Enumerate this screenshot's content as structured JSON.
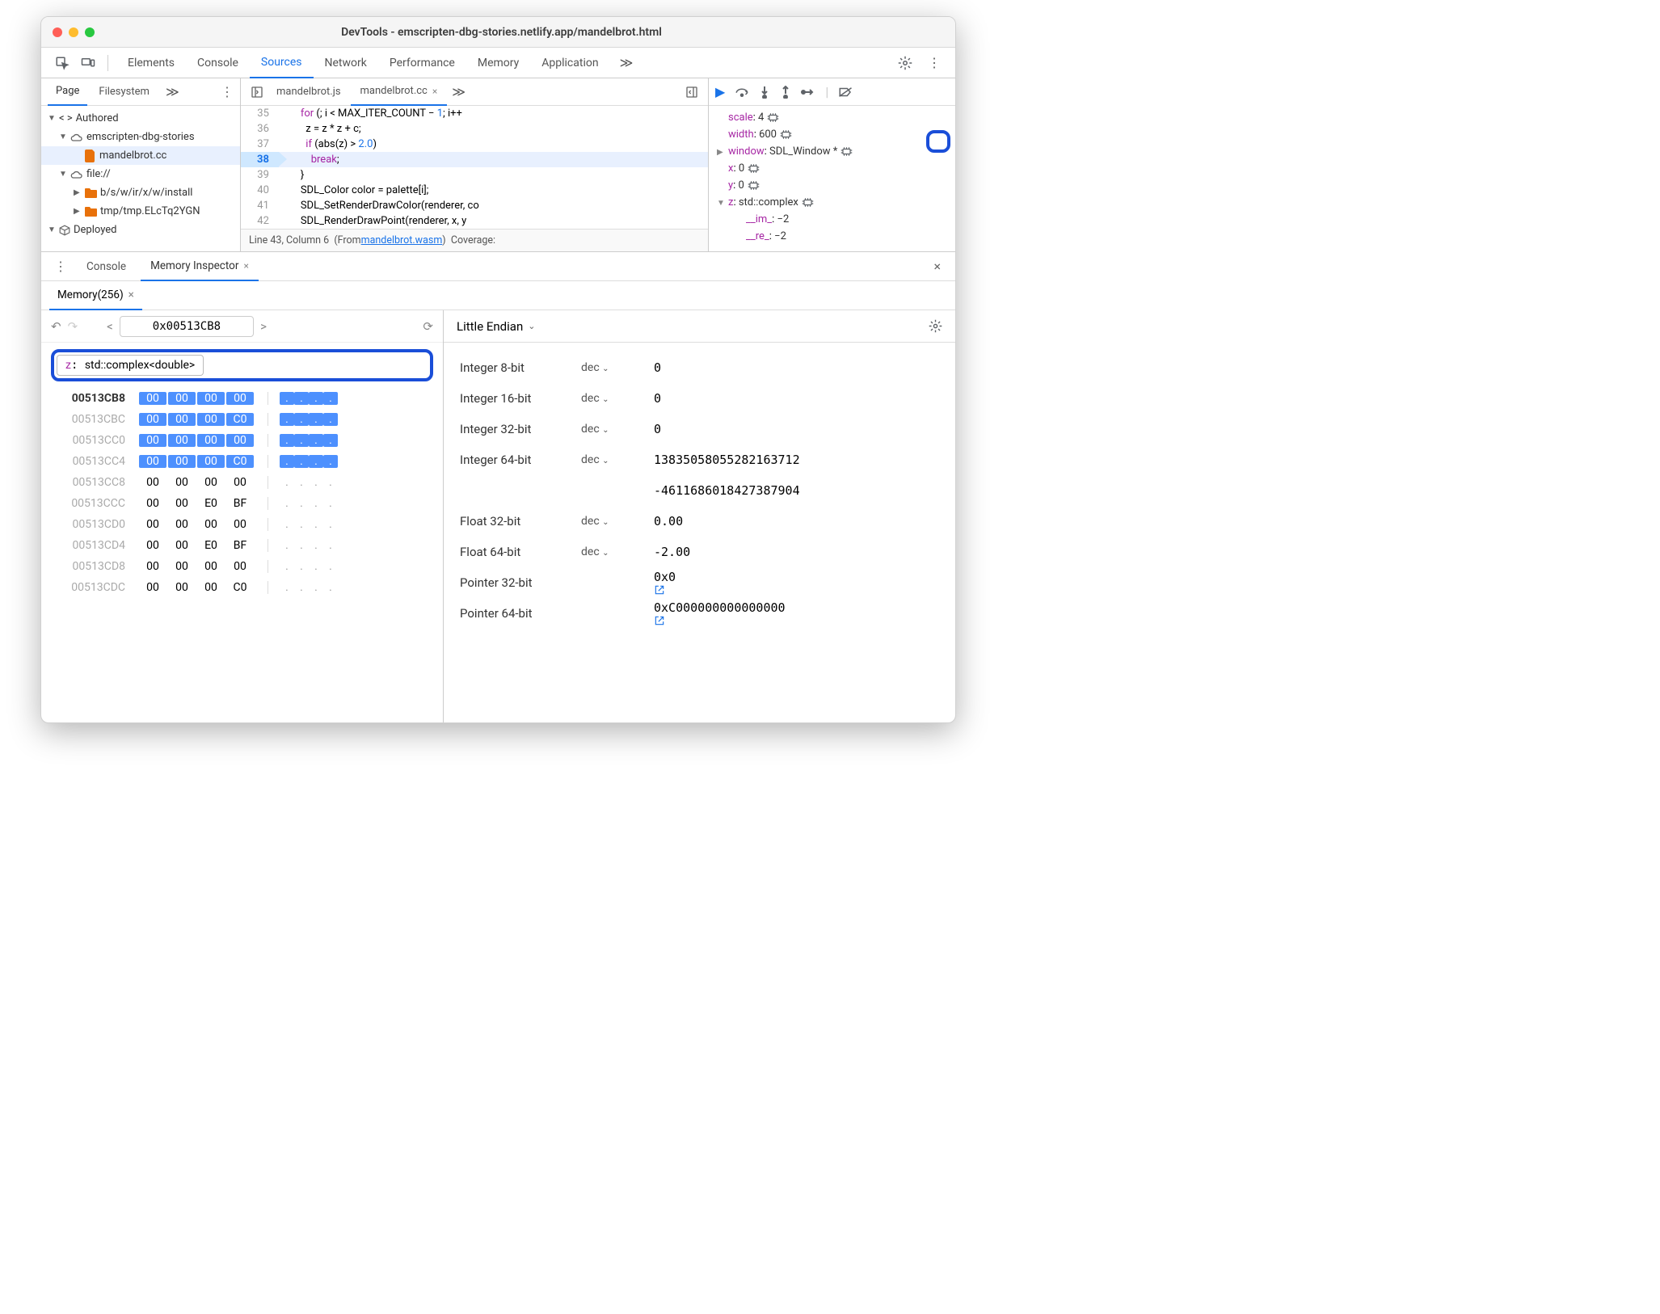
{
  "title": "DevTools - emscripten-dbg-stories.netlify.app/mandelbrot.html",
  "mainTabs": [
    "Elements",
    "Console",
    "Sources",
    "Network",
    "Performance",
    "Memory",
    "Application"
  ],
  "mainActive": "Sources",
  "leftTabs": [
    "Page",
    "Filesystem"
  ],
  "leftActive": "Page",
  "tree": {
    "authored": "Authored",
    "site": "emscripten-dbg-stories",
    "file": "mandelbrot.cc",
    "file2": "file://",
    "sub1": "b/s/w/ir/x/w/install",
    "sub2": "tmp/tmp.ELcTq2YGN",
    "deployed": "Deployed"
  },
  "codeTabs": [
    "mandelbrot.js",
    "mandelbrot.cc"
  ],
  "codeActive": "mandelbrot.cc",
  "codeLines": [
    {
      "n": 35,
      "t": "    for (; i < MAX_ITER_COUNT − 1; i++"
    },
    {
      "n": 36,
      "t": "      z = z * z + c;"
    },
    {
      "n": 37,
      "t": "      if (abs(z) > 2.0)"
    },
    {
      "n": 38,
      "t": "        break;",
      "cur": true
    },
    {
      "n": 39,
      "t": "    }"
    },
    {
      "n": 40,
      "t": "    SDL_Color color = palette[i];"
    },
    {
      "n": 41,
      "t": "    SDL_SetRenderDrawColor(renderer, co"
    },
    {
      "n": 42,
      "t": "    SDL_RenderDrawPoint(renderer, x, y"
    }
  ],
  "status": {
    "pos": "Line 43, Column 6",
    "from": "(From ",
    "wasm": "mandelbrot.wasm",
    "close": ")",
    "cov": "Coverage:"
  },
  "scope": [
    {
      "k": "scale",
      "v": "4",
      "icon": true
    },
    {
      "k": "width",
      "v": "600",
      "icon": true
    },
    {
      "k": "window",
      "v": "SDL_Window *",
      "icon": true,
      "exp": "▶"
    },
    {
      "k": "x",
      "v": "0",
      "icon": true
    },
    {
      "k": "y",
      "v": "0",
      "icon": true
    },
    {
      "k": "z",
      "v": "std::complex<double>",
      "icon": true,
      "exp": "▼",
      "hl": true
    },
    {
      "k": "__im_",
      "v": "−2",
      "indent": true
    },
    {
      "k": "__re_",
      "v": "−2",
      "indent": true
    }
  ],
  "drawer": {
    "console": "Console",
    "mi": "Memory Inspector",
    "mem": "Memory(256)"
  },
  "memToolbar": {
    "addr": "0x00513CB8",
    "chipK": "z",
    "chipV": "std::complex<double>"
  },
  "hex": [
    {
      "a": "00513CB8",
      "b": [
        "00",
        "00",
        "00",
        "00"
      ],
      "c": [
        ".",
        ".",
        ".",
        "."
      ],
      "hl": true,
      "bold": true
    },
    {
      "a": "00513CBC",
      "b": [
        "00",
        "00",
        "00",
        "C0"
      ],
      "c": [
        ".",
        ".",
        ".",
        "."
      ],
      "hl": true
    },
    {
      "a": "00513CC0",
      "b": [
        "00",
        "00",
        "00",
        "00"
      ],
      "c": [
        ".",
        ".",
        ".",
        "."
      ],
      "hl": true
    },
    {
      "a": "00513CC4",
      "b": [
        "00",
        "00",
        "00",
        "C0"
      ],
      "c": [
        ".",
        ".",
        ".",
        "."
      ],
      "hl": true
    },
    {
      "a": "00513CC8",
      "b": [
        "00",
        "00",
        "00",
        "00"
      ],
      "c": [
        ".",
        ".",
        ".",
        "."
      ]
    },
    {
      "a": "00513CCC",
      "b": [
        "00",
        "00",
        "E0",
        "BF"
      ],
      "c": [
        ".",
        ".",
        ".",
        "."
      ]
    },
    {
      "a": "00513CD0",
      "b": [
        "00",
        "00",
        "00",
        "00"
      ],
      "c": [
        ".",
        ".",
        ".",
        "."
      ]
    },
    {
      "a": "00513CD4",
      "b": [
        "00",
        "00",
        "E0",
        "BF"
      ],
      "c": [
        ".",
        ".",
        ".",
        "."
      ]
    },
    {
      "a": "00513CD8",
      "b": [
        "00",
        "00",
        "00",
        "00"
      ],
      "c": [
        ".",
        ".",
        ".",
        "."
      ]
    },
    {
      "a": "00513CDC",
      "b": [
        "00",
        "00",
        "00",
        "C0"
      ],
      "c": [
        ".",
        ".",
        ".",
        "."
      ]
    }
  ],
  "endian": "Little Endian",
  "vals": [
    {
      "l": "Integer 8-bit",
      "f": "dec",
      "v": "0"
    },
    {
      "l": "Integer 16-bit",
      "f": "dec",
      "v": "0"
    },
    {
      "l": "Integer 32-bit",
      "f": "dec",
      "v": "0"
    },
    {
      "l": "Integer 64-bit",
      "f": "dec",
      "v": "13835058055282163712"
    },
    {
      "l": "",
      "f": "",
      "v": "-4611686018427387904"
    },
    {
      "l": "Float 32-bit",
      "f": "dec",
      "v": "0.00"
    },
    {
      "l": "Float 64-bit",
      "f": "dec",
      "v": "-2.00"
    },
    {
      "l": "Pointer 32-bit",
      "f": "",
      "v": "0x0",
      "ext": true
    },
    {
      "l": "Pointer 64-bit",
      "f": "",
      "v": "0xC000000000000000",
      "ext": true
    }
  ]
}
